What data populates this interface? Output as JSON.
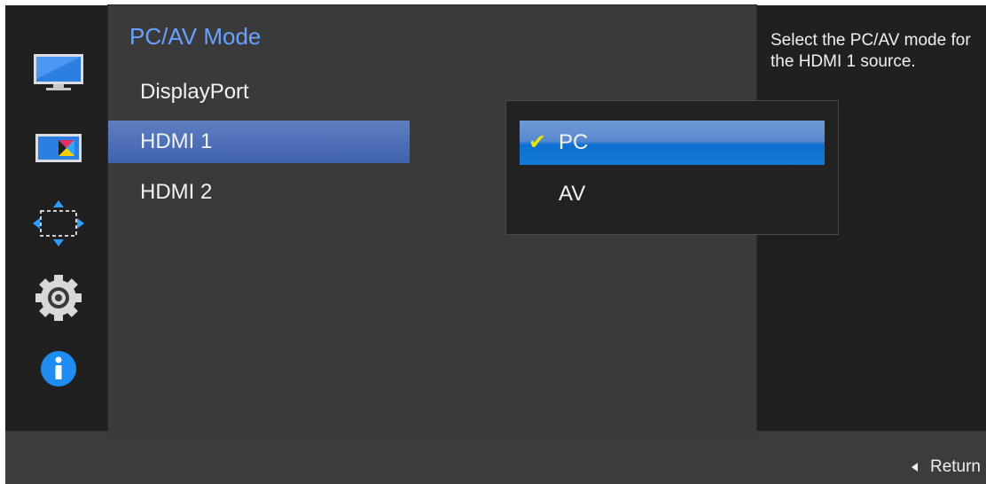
{
  "panel_title": "PC/AV Mode",
  "sources": [
    {
      "label": "DisplayPort",
      "selected": false
    },
    {
      "label": "HDMI 1",
      "selected": true
    },
    {
      "label": "HDMI 2",
      "selected": false
    }
  ],
  "mode_options": [
    {
      "label": "PC",
      "checked": true,
      "highlighted": true
    },
    {
      "label": "AV",
      "checked": false,
      "highlighted": false
    }
  ],
  "help_text": "Select the PC/AV mode for the HDMI 1 source.",
  "footer": {
    "return_label": "Return"
  },
  "sidebar_icons": [
    "picture-icon",
    "color-icon",
    "size-position-icon",
    "setup-gear-icon",
    "information-icon"
  ],
  "colors": {
    "accent_title": "#6aa0ff",
    "selection": "#3f62ad",
    "checkmark": "#e6e600"
  }
}
